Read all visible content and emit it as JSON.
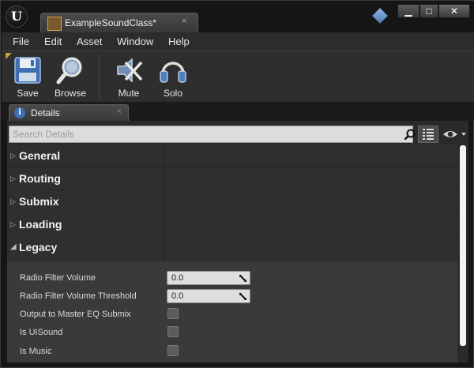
{
  "window": {
    "tab_title": "ExampleSoundClass",
    "tab_modified_marker": "*",
    "tab_close": "×",
    "controls": {
      "minimize": "▁",
      "maximize": "□",
      "close": "✕"
    }
  },
  "menu": [
    "File",
    "Edit",
    "Asset",
    "Window",
    "Help"
  ],
  "toolbar": {
    "save": "Save",
    "browse": "Browse",
    "mute": "Mute",
    "solo": "Solo"
  },
  "details": {
    "tab_label": "Details",
    "tab_close": "×",
    "search_placeholder": "Search Details",
    "categories": [
      {
        "label": "General",
        "expanded": false
      },
      {
        "label": "Routing",
        "expanded": false
      },
      {
        "label": "Submix",
        "expanded": false
      },
      {
        "label": "Loading",
        "expanded": false
      },
      {
        "label": "Legacy",
        "expanded": true
      }
    ],
    "properties": [
      {
        "label": "Radio Filter Volume",
        "value": "0.0"
      },
      {
        "label": "Radio Filter Volume Threshold",
        "value": "0.0"
      },
      {
        "label": "Output to Master EQ Submix",
        "checked": false
      },
      {
        "label": "Is UISound",
        "checked": false
      },
      {
        "label": "Is Music",
        "checked": false
      }
    ]
  },
  "colors": {
    "accent": "#c8a23a",
    "panel": "#2a2a2a",
    "info": "#3d6db3"
  }
}
